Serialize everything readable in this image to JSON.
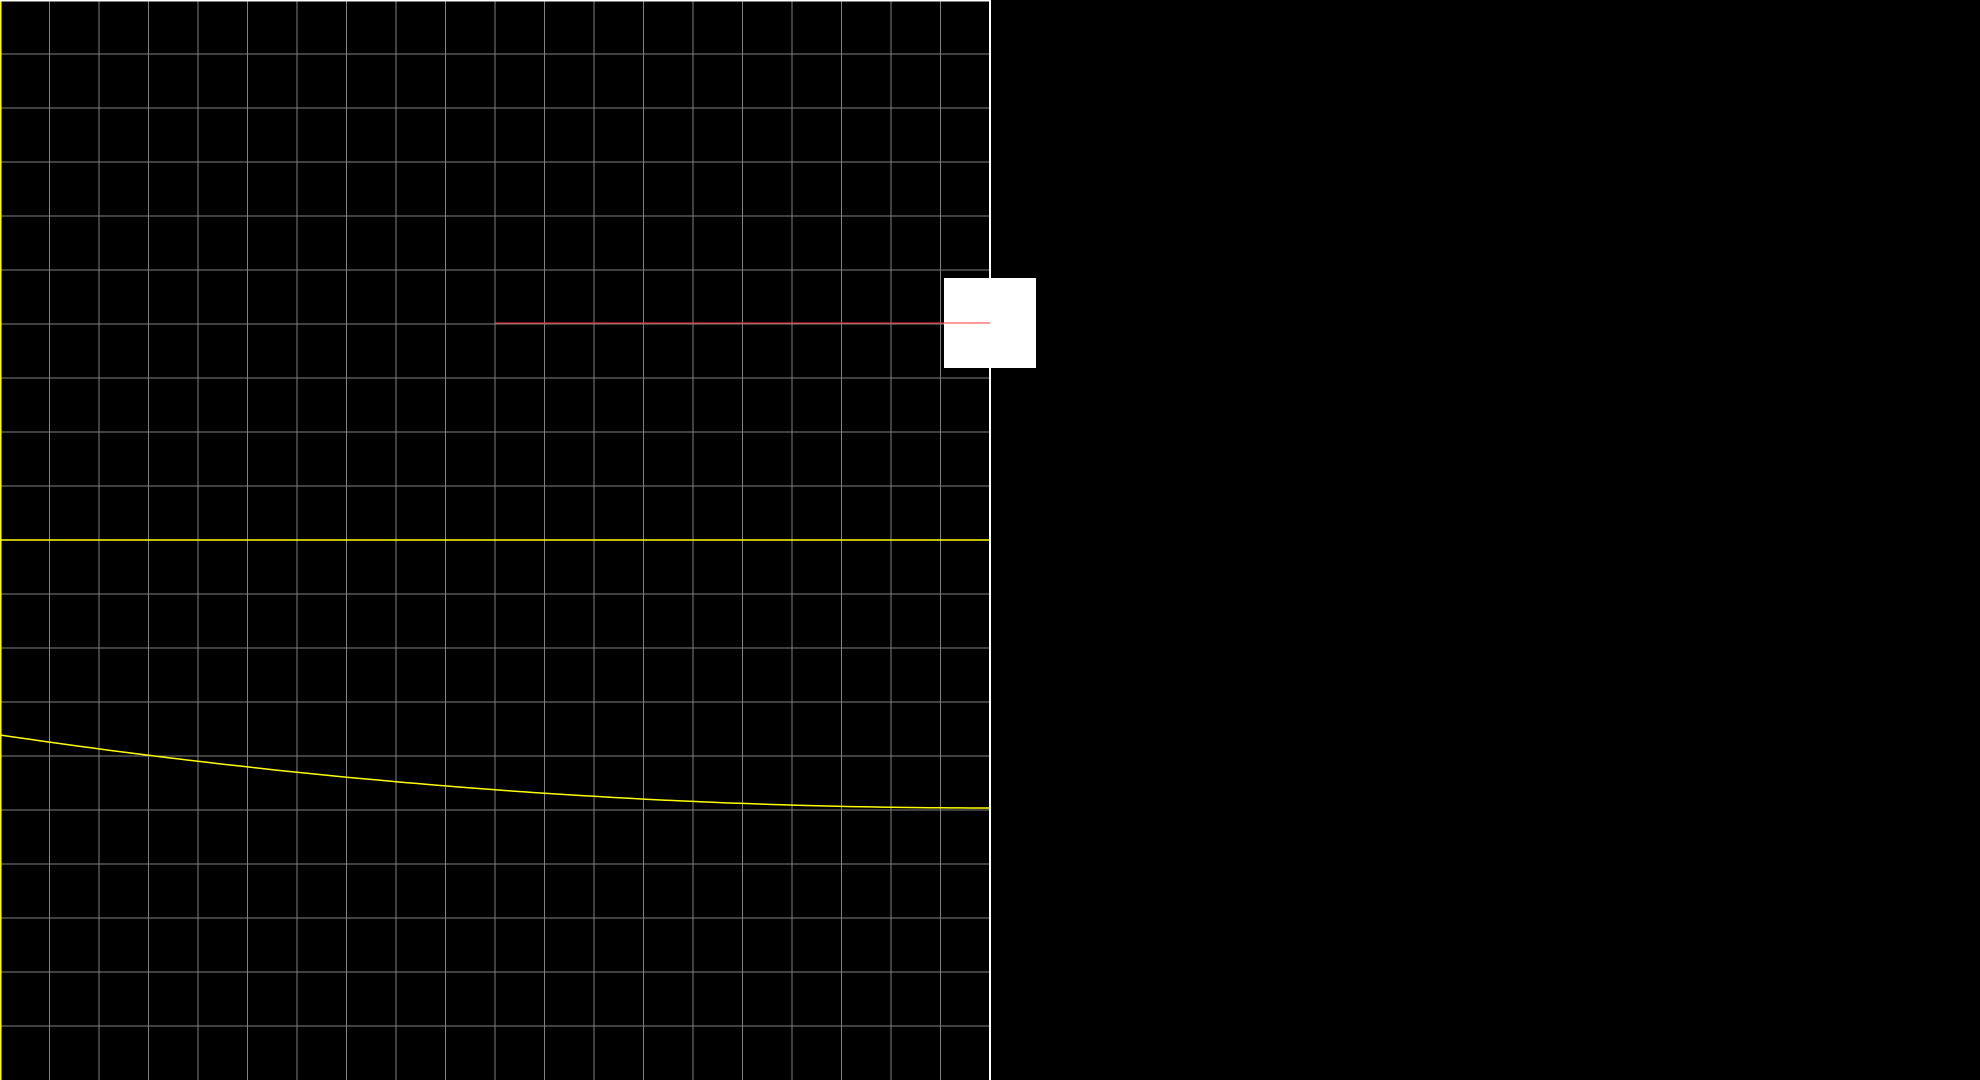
{
  "scene": {
    "background_color": "#000000",
    "canvas_background": "#000000",
    "grid": {
      "visible": true,
      "columns": 20,
      "rows": 20,
      "color": "#808080"
    },
    "border_color": "#ffffff",
    "ruler_line_color": "#ffff00",
    "curve_color": "#ffff00",
    "marker_line_color": "#ff3333",
    "handle": {
      "color": "#ffffff",
      "level": 0.3
    },
    "horizontal_line_level": 0.5
  }
}
